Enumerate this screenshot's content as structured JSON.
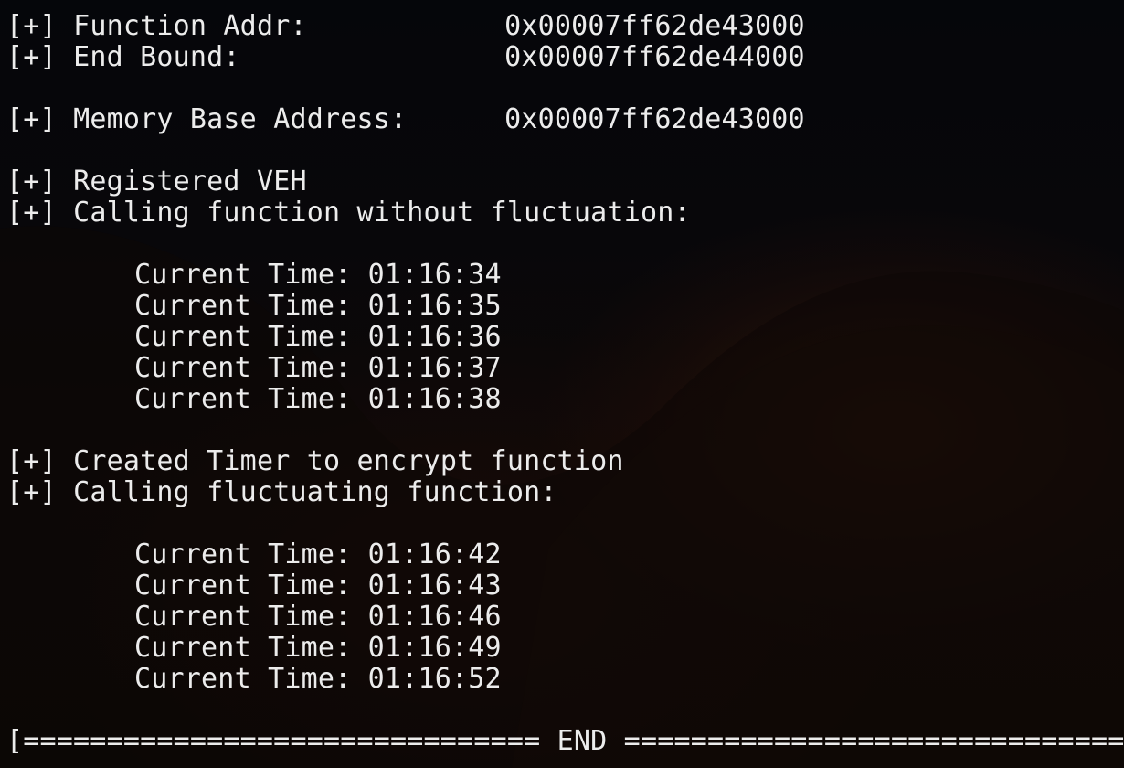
{
  "terminal": {
    "header_lines": [
      {
        "prefix": "[+]",
        "label": "Function Addr:",
        "value": "0x00007ff62de43000"
      },
      {
        "prefix": "[+]",
        "label": "End Bound:",
        "value": "0x00007ff62de44000"
      }
    ],
    "memory_line": {
      "prefix": "[+]",
      "label": "Memory Base Address:",
      "value": "0x00007ff62de43000"
    },
    "veh_lines": [
      {
        "prefix": "[+]",
        "text": "Registered VEH"
      },
      {
        "prefix": "[+]",
        "text": "Calling function without fluctuation:"
      }
    ],
    "times_without_fluctuation": [
      "Current Time: 01:16:34",
      "Current Time: 01:16:35",
      "Current Time: 01:16:36",
      "Current Time: 01:16:37",
      "Current Time: 01:16:38"
    ],
    "timer_lines": [
      {
        "prefix": "[+]",
        "text": "Created Timer to encrypt function"
      },
      {
        "prefix": "[+]",
        "text": "Calling fluctuating function:"
      }
    ],
    "times_fluctuating": [
      "Current Time: 01:16:42",
      "Current Time: 01:16:43",
      "Current Time: 01:16:46",
      "Current Time: 01:16:49",
      "Current Time: 01:16:52"
    ],
    "end_banner": "[=============================== END ===============================]"
  },
  "colors": {
    "text": "#ececec",
    "background": "#050608",
    "glow": "#4a1e0a"
  }
}
